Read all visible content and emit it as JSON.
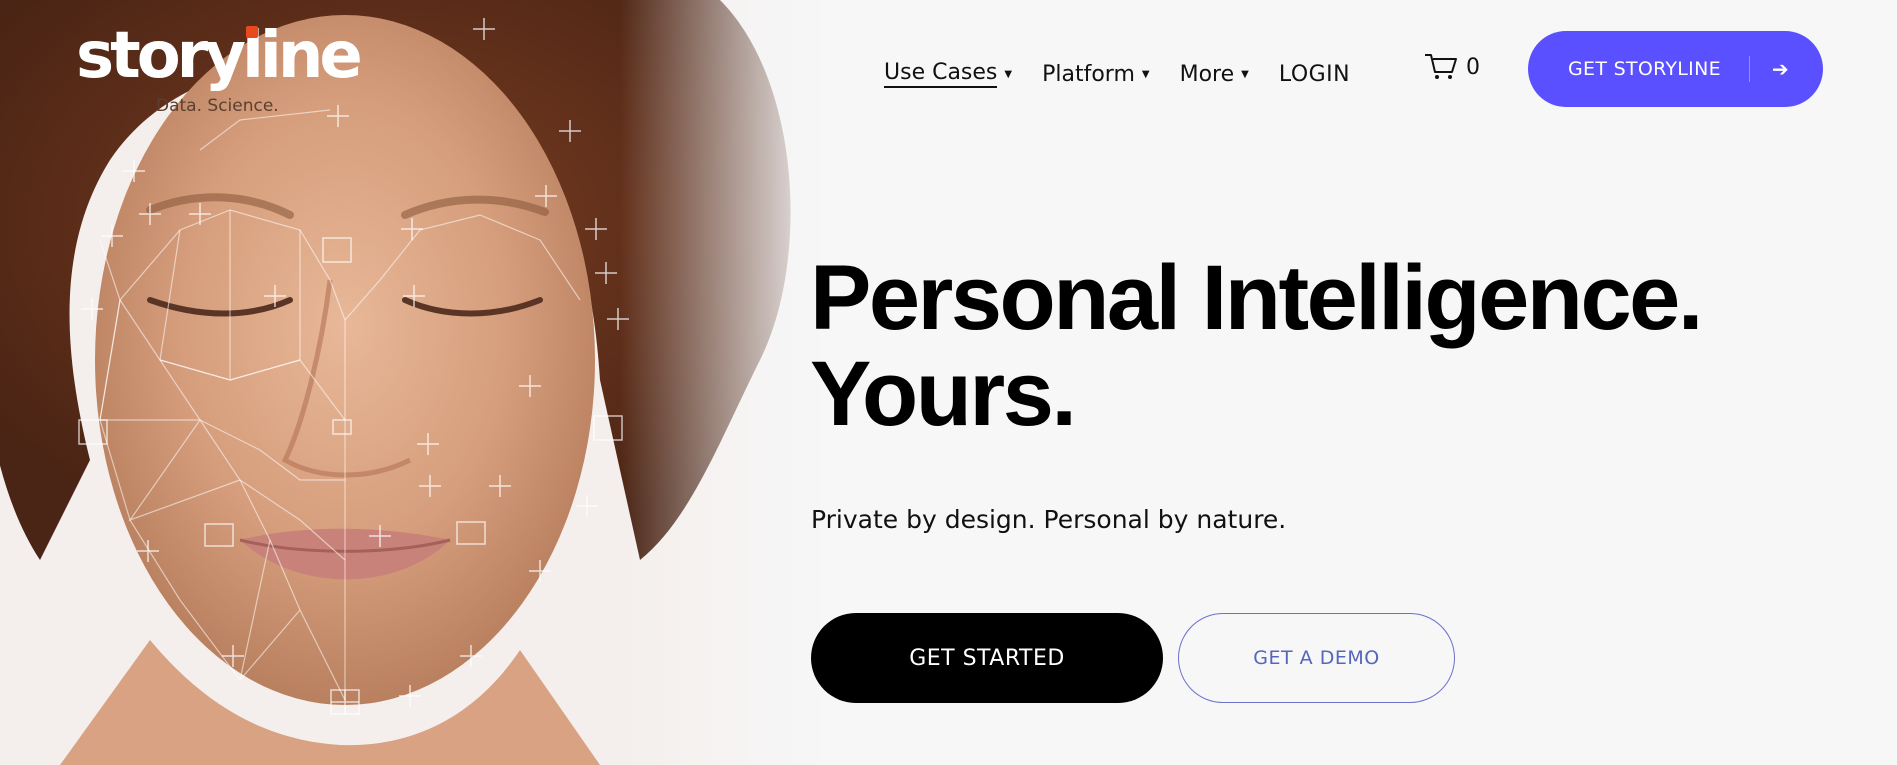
{
  "brand": {
    "name": "storyline",
    "tagline": "Data. Science.",
    "accent_color": "#e8491f"
  },
  "nav": {
    "items": [
      {
        "label": "Use Cases",
        "has_dropdown": true,
        "active": true
      },
      {
        "label": "Platform",
        "has_dropdown": true,
        "active": false
      },
      {
        "label": "More",
        "has_dropdown": true,
        "active": false
      }
    ],
    "login": "LOGIN",
    "cart_count": "0",
    "cart_icon": "cart-icon",
    "cta": {
      "label": "GET STORYLINE",
      "arrow": "➔",
      "color": "#5b50ff"
    }
  },
  "hero": {
    "headline_line1": "Personal Intelligence.",
    "headline_line2": "Yours.",
    "subline": "Private by design. Personal by nature.",
    "primary_button": "GET STARTED",
    "secondary_button": "GET A DEMO"
  }
}
